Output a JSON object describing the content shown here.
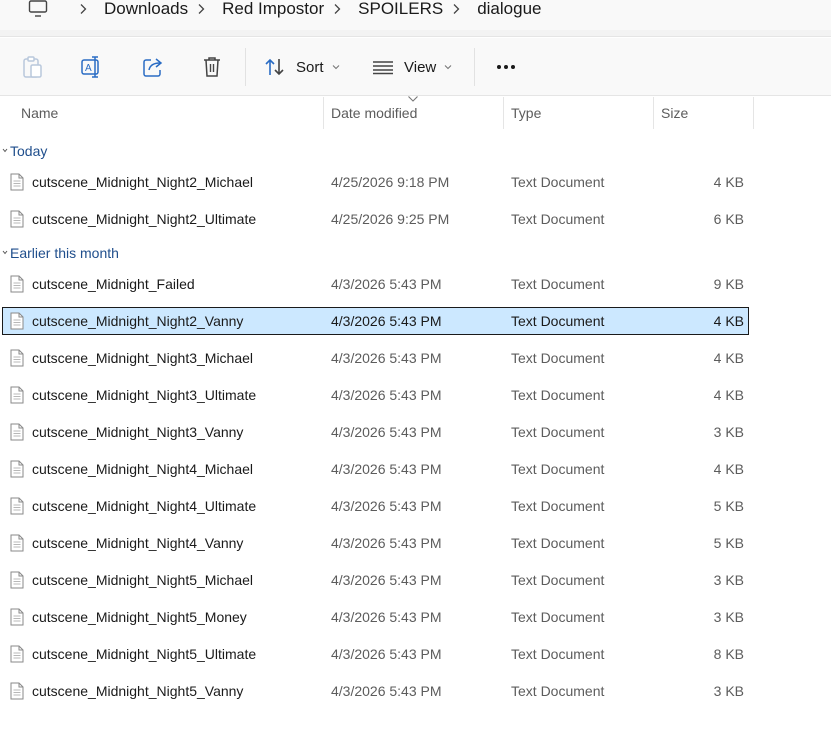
{
  "breadcrumb": {
    "items": [
      "Downloads",
      "Red Impostor",
      "SPOILERS",
      "dialogue"
    ]
  },
  "toolbar": {
    "sort_label": "Sort",
    "view_label": "View",
    "more_label": "•••"
  },
  "columns": {
    "name": "Name",
    "date": "Date modified",
    "type": "Type",
    "size": "Size"
  },
  "groups": [
    {
      "label": "Today",
      "files": [
        {
          "name": "cutscene_Midnight_Night2_Michael",
          "date": "4/25/2026 9:18 PM",
          "type": "Text Document",
          "size": "4 KB"
        },
        {
          "name": "cutscene_Midnight_Night2_Ultimate",
          "date": "4/25/2026 9:25 PM",
          "type": "Text Document",
          "size": "6 KB"
        }
      ]
    },
    {
      "label": "Earlier this month",
      "files": [
        {
          "name": "cutscene_Midnight_Failed",
          "date": "4/3/2026 5:43 PM",
          "type": "Text Document",
          "size": "9 KB"
        },
        {
          "name": "cutscene_Midnight_Night2_Vanny",
          "date": "4/3/2026 5:43 PM",
          "type": "Text Document",
          "size": "4 KB",
          "selected": true
        },
        {
          "name": "cutscene_Midnight_Night3_Michael",
          "date": "4/3/2026 5:43 PM",
          "type": "Text Document",
          "size": "4 KB"
        },
        {
          "name": "cutscene_Midnight_Night3_Ultimate",
          "date": "4/3/2026 5:43 PM",
          "type": "Text Document",
          "size": "4 KB"
        },
        {
          "name": "cutscene_Midnight_Night3_Vanny",
          "date": "4/3/2026 5:43 PM",
          "type": "Text Document",
          "size": "3 KB"
        },
        {
          "name": "cutscene_Midnight_Night4_Michael",
          "date": "4/3/2026 5:43 PM",
          "type": "Text Document",
          "size": "4 KB"
        },
        {
          "name": "cutscene_Midnight_Night4_Ultimate",
          "date": "4/3/2026 5:43 PM",
          "type": "Text Document",
          "size": "5 KB"
        },
        {
          "name": "cutscene_Midnight_Night4_Vanny",
          "date": "4/3/2026 5:43 PM",
          "type": "Text Document",
          "size": "5 KB"
        },
        {
          "name": "cutscene_Midnight_Night5_Michael",
          "date": "4/3/2026 5:43 PM",
          "type": "Text Document",
          "size": "3 KB"
        },
        {
          "name": "cutscene_Midnight_Night5_Money",
          "date": "4/3/2026 5:43 PM",
          "type": "Text Document",
          "size": "3 KB"
        },
        {
          "name": "cutscene_Midnight_Night5_Ultimate",
          "date": "4/3/2026 5:43 PM",
          "type": "Text Document",
          "size": "8 KB"
        },
        {
          "name": "cutscene_Midnight_Night5_Vanny",
          "date": "4/3/2026 5:43 PM",
          "type": "Text Document",
          "size": "3 KB"
        }
      ]
    }
  ],
  "colors": {
    "accent": "#1f4e8c",
    "selection": "#cce8ff",
    "icon_blue": "#2a6cc4"
  },
  "icons": {
    "pc": "monitor-icon",
    "separator": "chevron-right-icon",
    "paste": "paste-icon",
    "rename": "rename-icon",
    "share": "share-icon",
    "delete": "trash-icon",
    "sort": "sort-arrows-icon",
    "view": "view-list-icon",
    "more": "more-icon",
    "file": "text-document-icon",
    "group": "chevron-down-icon"
  }
}
